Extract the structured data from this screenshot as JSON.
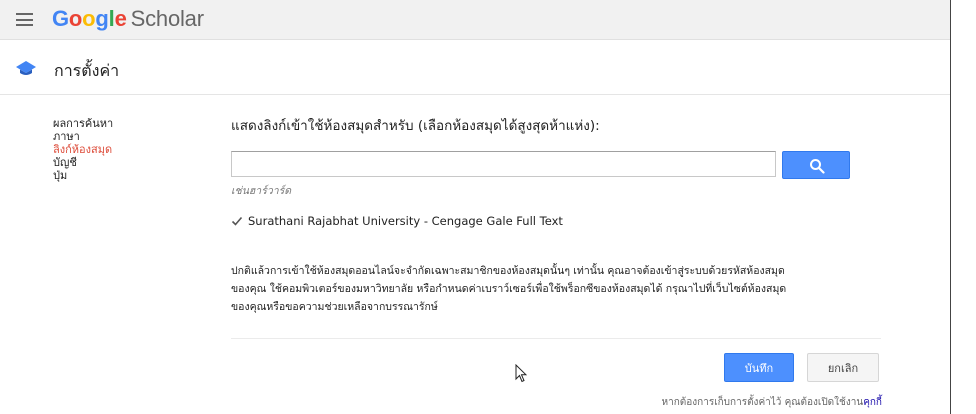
{
  "header": {
    "logo_letters": [
      {
        "ch": "G",
        "color": "#4285f4"
      },
      {
        "ch": "o",
        "color": "#ea4335"
      },
      {
        "ch": "o",
        "color": "#fbbc05"
      },
      {
        "ch": "g",
        "color": "#4285f4"
      },
      {
        "ch": "l",
        "color": "#34a853"
      },
      {
        "ch": "e",
        "color": "#ea4335"
      }
    ],
    "logo_suffix": "Scholar"
  },
  "settings_bar": {
    "title": "การตั้งค่า",
    "icon": "graduation-cap-icon"
  },
  "sidebar": {
    "items": [
      {
        "label": "ผลการค้นหา",
        "active": false
      },
      {
        "label": "ภาษา",
        "active": false
      },
      {
        "label": "ลิงก์ห้องสมุด",
        "active": true
      },
      {
        "label": "บัญชี",
        "active": false
      },
      {
        "label": "ปุ่ม",
        "active": false
      }
    ]
  },
  "main": {
    "heading": "แสดงลิงก์เข้าใช้ห้องสมุดสำหรับ (เลือกห้องสมุดได้สูงสุดห้าแห่ง):",
    "search": {
      "value": "",
      "placeholder": ""
    },
    "search_icon": "search-icon",
    "example": "เช่นฮาร์วาร์ด",
    "library": {
      "label": "Surathani Rajabhat University - Cengage Gale Full Text",
      "checked": true
    },
    "notice_lines": [
      "ปกติแล้วการเข้าใช้ห้องสมุดออนไลน์จะจำกัดเฉพาะสมาชิกของห้องสมุดนั้นๆ เท่านั้น คุณอาจต้องเข้าสู่ระบบด้วยรหัสห้องสมุด",
      "ของคุณ ใช้คอมพิวเตอร์ของมหาวิทยาลัย หรือกำหนดค่าเบราว์เซอร์เพื่อใช้พร็อกซีของห้องสมุดได้ กรุณาไปที่เว็บไซต์ห้องสมุด",
      "ของคุณหรือขอความช่วยเหลือจากบรรณารักษ์"
    ],
    "save_label": "บันทึก",
    "cancel_label": "ยกเลิก",
    "cookie_text": "หากต้องการเก็บการตั้งค่าไว้ คุณต้องเปิดใช้งาน",
    "cookie_link": "คุกกี้"
  },
  "colors": {
    "accent_blue": "#4d90fe",
    "active_red": "#dd4b39",
    "link_blue": "#1a0dab"
  }
}
